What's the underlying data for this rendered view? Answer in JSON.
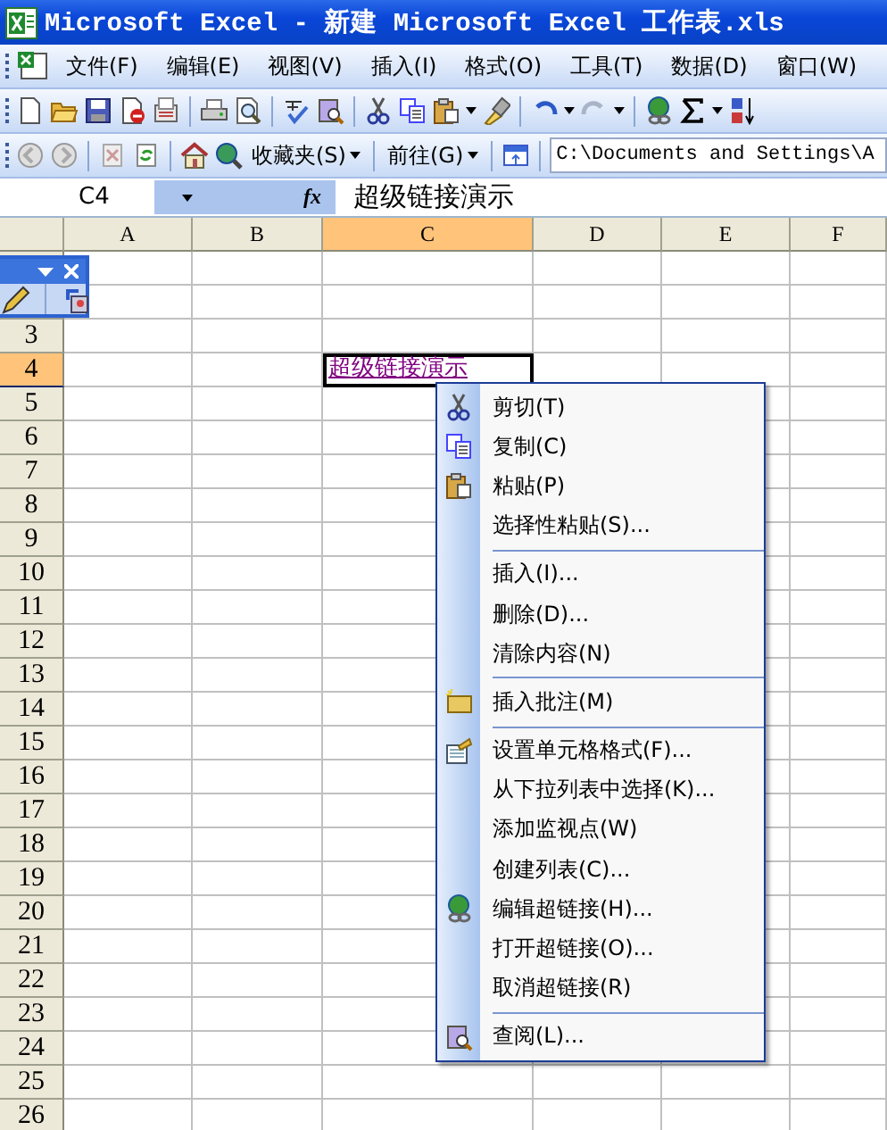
{
  "window": {
    "title": "Microsoft Excel - 新建 Microsoft Excel 工作表.xls"
  },
  "menu": [
    "文件(F)",
    "编辑(E)",
    "视图(V)",
    "插入(I)",
    "格式(O)",
    "工具(T)",
    "数据(D)",
    "窗口(W)"
  ],
  "web_toolbar": {
    "favorites": "收藏夹(S)",
    "go": "前往(G)",
    "address": "C:\\Documents and Settings\\A"
  },
  "formula_bar": {
    "name_box": "C4",
    "fx": "fx",
    "content": "超级链接演示"
  },
  "columns": [
    {
      "label": "A",
      "selected": false
    },
    {
      "label": "B",
      "selected": false
    },
    {
      "label": "C",
      "selected": true
    },
    {
      "label": "D",
      "selected": false
    },
    {
      "label": "E",
      "selected": false
    },
    {
      "label": "F",
      "selected": false
    }
  ],
  "rows": [
    {
      "label": "3",
      "selected": false
    },
    {
      "label": "4",
      "selected": true
    },
    {
      "label": "5",
      "selected": false
    },
    {
      "label": "6",
      "selected": false
    },
    {
      "label": "7",
      "selected": false
    },
    {
      "label": "8",
      "selected": false
    },
    {
      "label": "9",
      "selected": false
    },
    {
      "label": "10",
      "selected": false
    },
    {
      "label": "11",
      "selected": false
    },
    {
      "label": "12",
      "selected": false
    },
    {
      "label": "13",
      "selected": false
    },
    {
      "label": "14",
      "selected": false
    },
    {
      "label": "15",
      "selected": false
    },
    {
      "label": "16",
      "selected": false
    },
    {
      "label": "17",
      "selected": false
    },
    {
      "label": "18",
      "selected": false
    },
    {
      "label": "19",
      "selected": false
    },
    {
      "label": "20",
      "selected": false
    },
    {
      "label": "21",
      "selected": false
    },
    {
      "label": "22",
      "selected": false
    },
    {
      "label": "23",
      "selected": false
    },
    {
      "label": "24",
      "selected": false
    },
    {
      "label": "25",
      "selected": false
    },
    {
      "label": "26",
      "selected": false
    }
  ],
  "active_cell": {
    "text": "超级链接演示"
  },
  "context_menu": {
    "groups": [
      [
        "剪切(T)",
        "复制(C)",
        "粘贴(P)",
        "选择性粘贴(S)..."
      ],
      [
        "插入(I)...",
        "删除(D)...",
        "清除内容(N)"
      ],
      [
        "插入批注(M)"
      ],
      [
        "设置单元格格式(F)...",
        "从下拉列表中选择(K)...",
        "添加监视点(W)",
        "创建列表(C)...",
        "编辑超链接(H)...",
        "打开超链接(O)...",
        "取消超链接(R)"
      ],
      [
        "查阅(L)..."
      ]
    ]
  }
}
